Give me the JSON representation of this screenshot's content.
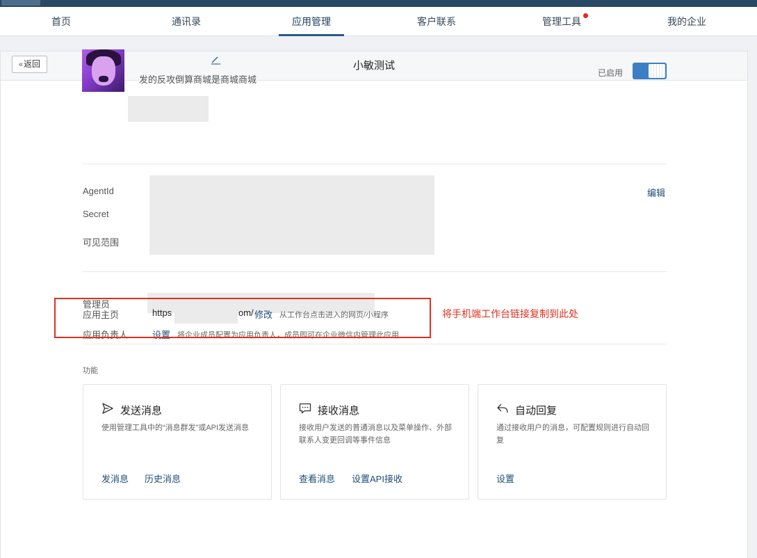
{
  "nav": {
    "tabs": [
      {
        "label": "首页"
      },
      {
        "label": "通讯录"
      },
      {
        "label": "应用管理"
      },
      {
        "label": "客户联系"
      },
      {
        "label": "管理工具"
      },
      {
        "label": "我的企业"
      }
    ],
    "active_tab": "应用管理",
    "notification_dot_on": "管理工具"
  },
  "header": {
    "back_label": "返回",
    "title": "小敏测试"
  },
  "app": {
    "description": "发的反攻倒算商城是商城商城",
    "status_label": "已启用",
    "enabled": true
  },
  "credentials": {
    "agentid_label": "AgentId",
    "secret_label": "Secret",
    "visibility_label": "可见范围",
    "edit_label": "编辑"
  },
  "settings": {
    "admin_label": "管理员",
    "owner_label": "应用负责人",
    "owner_action": "设置",
    "owner_hint": "将企业成员配置为应用负责人，成员即可在企业微信内管理此应用",
    "homepage_label": "应用主页",
    "homepage_url_start": "https",
    "homepage_url_end": "om/",
    "homepage_action": "修改",
    "homepage_hint": "从工作台点击进入的网页/小程序"
  },
  "annotation": {
    "text": "将手机端工作台链接复制到此处"
  },
  "features": {
    "section_label": "功能",
    "cards": [
      {
        "icon": "send-icon",
        "title": "发送消息",
        "desc": "使用管理工具中的“消息群发”或API发送消息",
        "links": [
          "发消息",
          "历史消息"
        ]
      },
      {
        "icon": "chat-bubble-icon",
        "title": "接收消息",
        "desc": "接收用户发送的普通消息以及菜单操作、外部联系人变更回调等事件信息",
        "links": [
          "查看消息",
          "设置API接收"
        ]
      },
      {
        "icon": "reply-icon",
        "title": "自动回复",
        "desc": "通过接收用户的消息，可配置规则进行自动回复",
        "links": [
          "设置"
        ]
      }
    ]
  },
  "colors": {
    "accent": "#2c5a85",
    "link": "#1f4e79",
    "toggle_on": "#3d7fc4",
    "callout": "#e0301e"
  }
}
